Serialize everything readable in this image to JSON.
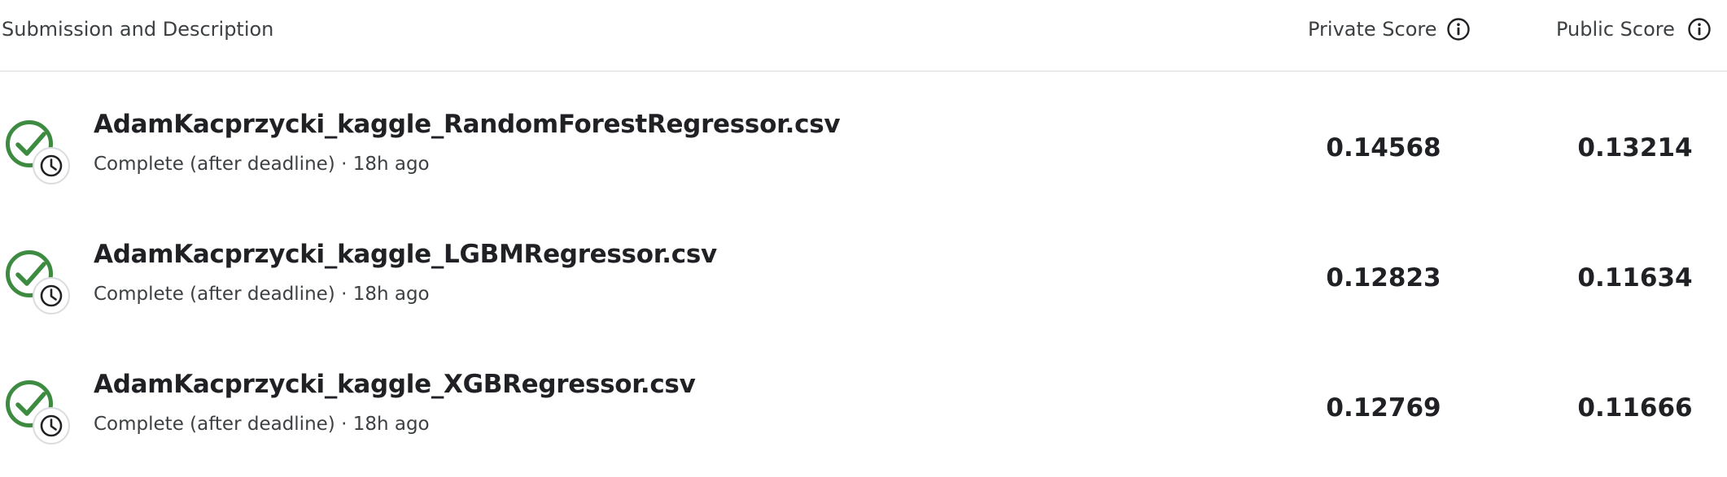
{
  "header": {
    "submission_label": "Submission and Description",
    "private_label": "Private Score",
    "public_label": "Public Score"
  },
  "colors": {
    "success_green": "#3d8b40",
    "text_primary": "#202124",
    "text_secondary": "#3c4043",
    "divider": "#dadce0"
  },
  "icons": {
    "status": "check-circle-with-clock-icon",
    "info": "info-icon"
  },
  "submissions": [
    {
      "file_name": "AdamKacprzycki_kaggle_RandomForestRegressor.csv",
      "status_text": "Complete (after deadline) · 18h ago",
      "private_score": "0.14568",
      "public_score": "0.13214"
    },
    {
      "file_name": "AdamKacprzycki_kaggle_LGBMRegressor.csv",
      "status_text": "Complete (after deadline) · 18h ago",
      "private_score": "0.12823",
      "public_score": "0.11634"
    },
    {
      "file_name": "AdamKacprzycki_kaggle_XGBRegressor.csv",
      "status_text": "Complete (after deadline) · 18h ago",
      "private_score": "0.12769",
      "public_score": "0.11666"
    }
  ]
}
